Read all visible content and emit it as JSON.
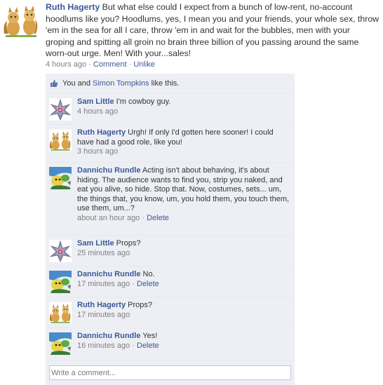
{
  "post": {
    "author": "Ruth Hagerty",
    "text": " But what else could I expect from a bunch of low-rent, no-account hoodlums like you? Hoodlums, yes, I mean you and your friends, your whole sex, throw 'em in the sea for all I care, throw 'em in and wait for the bubbles, men with your groping and spitting all groin no brain three billion of you passing around the same worn-out urge. Men! With your...sales!",
    "time": "4 hours ago",
    "sep": " · ",
    "comment_label": "Comment",
    "unlike_label": "Unlike",
    "avatar_icon": "squirrel-avatar-icon"
  },
  "likes": {
    "you": "You and ",
    "friend": "Simon Tompkins",
    "suffix": " like this.",
    "icon": "thumbs-up-icon"
  },
  "comments": [
    {
      "author": "Sam Little",
      "text": " I'm cowboy guy.",
      "time": "4 hours ago",
      "delete": "",
      "avatar": "starmie-avatar-icon"
    },
    {
      "author": "Ruth Hagerty",
      "text": " Urgh! If only I'd gotten here sooner! I could have had a good role, like you!",
      "time": "3 hours ago",
      "delete": "",
      "avatar": "squirrel-avatar-icon"
    },
    {
      "author": "Dannichu Rundle",
      "text": " Acting isn't about behaving, it's about hiding. The audience wants to find you, strip you naked, and eat you alive, so hide. Stop that. Now, costumes, sets... um, the things that, you know, um, you hold them, you touch them, use them, um...?",
      "time": "about an hour ago",
      "delete": "Delete",
      "avatar": "creature-avatar-icon"
    },
    {
      "author": "Sam Little",
      "text": " Props?",
      "time": "25 minutes ago",
      "delete": "",
      "avatar": "starmie-avatar-icon"
    },
    {
      "author": "Dannichu Rundle",
      "text": " No.",
      "time": "17 minutes ago",
      "delete": "Delete",
      "avatar": "creature-avatar-icon"
    },
    {
      "author": "Ruth Hagerty",
      "text": " Props?",
      "time": "17 minutes ago",
      "delete": "",
      "avatar": "squirrel-avatar-icon"
    },
    {
      "author": "Dannichu Rundle",
      "text": " Yes!",
      "time": "16 minutes ago",
      "delete": "Delete",
      "avatar": "creature-avatar-icon"
    }
  ],
  "write_comment": {
    "placeholder": "Write a comment..."
  },
  "colors": {
    "link": "#3b5998",
    "feedback_bg": "#edeff4",
    "meta_gray": "#808080"
  }
}
